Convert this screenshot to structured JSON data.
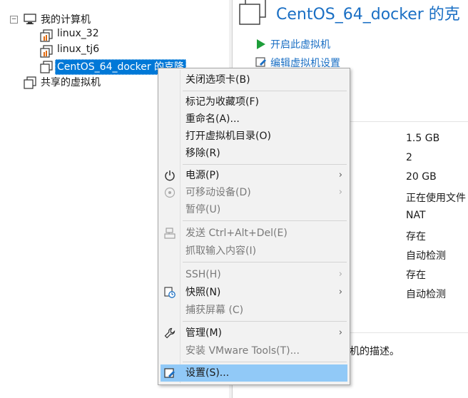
{
  "tree": {
    "my_computer": "我的计算机",
    "vms": [
      "linux_32",
      "linux_tj6"
    ],
    "selected_vm": "CentOS_64_docker 的克隆",
    "shared": "共享的虚拟机"
  },
  "vm": {
    "title": "CentOS_64_docker 的克",
    "actions": [
      "开启此虚拟机",
      "编辑虚拟机设置"
    ],
    "specs": [
      "1.5 GB",
      "2",
      "20 GB",
      "正在使用文件",
      "NAT",
      "存在",
      "自动检测",
      "存在",
      "自动检测"
    ],
    "description_fragment": "机的描述。"
  },
  "menu": {
    "items": [
      {
        "label": "关闭选项卡(B)"
      },
      {
        "label": "标记为收藏项(F)"
      },
      {
        "label": "重命名(A)..."
      },
      {
        "label": "打开虚拟机目录(O)"
      },
      {
        "label": "移除(R)"
      },
      {
        "label": "电源(P)"
      },
      {
        "label": "可移动设备(D)"
      },
      {
        "label": "暂停(U)"
      },
      {
        "label": "发送 Ctrl+Alt+Del(E)"
      },
      {
        "label": "抓取输入内容(I)"
      },
      {
        "label": "SSH(H)"
      },
      {
        "label": "快照(N)"
      },
      {
        "label": "捕获屏幕 (C)"
      },
      {
        "label": "管理(M)"
      },
      {
        "label": "安装 VMware Tools(T)..."
      },
      {
        "label": "设置(S)..."
      }
    ]
  },
  "colors": {
    "accent": "#1a6fc4",
    "selection": "#0078d7",
    "menu_highlight": "#91c9f7",
    "play": "#1e9e3a",
    "vm_icon_orange": "#e06a10"
  }
}
